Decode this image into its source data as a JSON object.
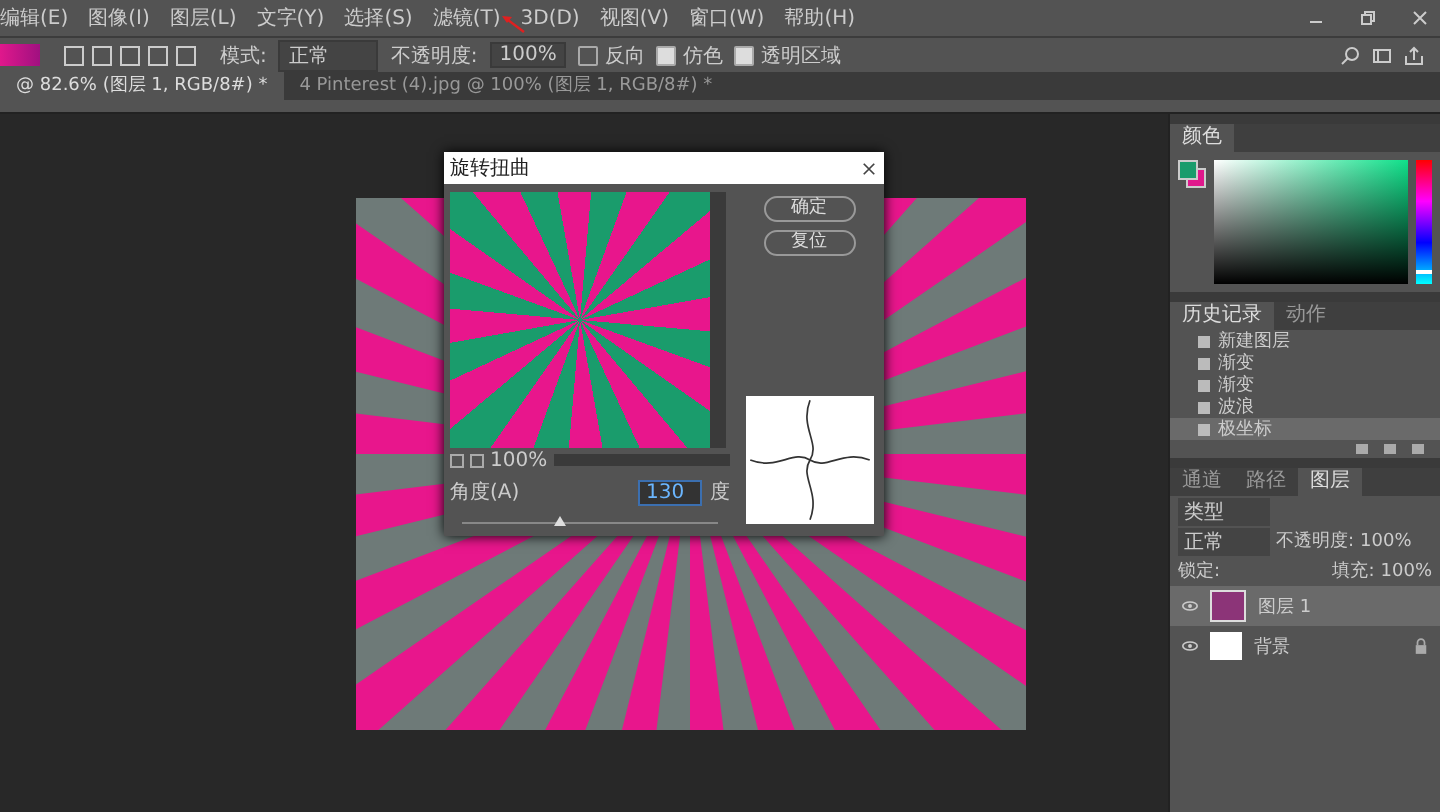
{
  "menu": [
    "编辑(E)",
    "图像(I)",
    "图层(L)",
    "文字(Y)",
    "选择(S)",
    "滤镜(T)",
    "3D(D)",
    "视图(V)",
    "窗口(W)",
    "帮助(H)"
  ],
  "options": {
    "mode_label": "模式:",
    "mode": "正常",
    "opacity_label": "不透明度:",
    "opacity": "100%",
    "toggles": [
      {
        "label": "反向",
        "checked": false
      },
      {
        "label": "仿色",
        "checked": true
      },
      {
        "label": "透明区域",
        "checked": true
      }
    ]
  },
  "doc_tabs": [
    {
      "label": "@ 82.6% (图层 1, RGB/8#) *",
      "selected": true
    },
    {
      "label": "4 Pinterest (4).jpg @ 100% (图层 1, RGB/8#) *",
      "selected": false
    }
  ],
  "dialog": {
    "title": "旋转扭曲",
    "buttons": [
      "确定",
      "复位"
    ],
    "zoom": "100%",
    "angle_label": "角度(A)",
    "angle_value": "130",
    "unit": "度",
    "level": 0.38
  },
  "color_panel": {
    "tab": "颜色",
    "hue_slider": {
      "level": 0.92
    }
  },
  "history": {
    "tabs": [
      {
        "label": "历史记录",
        "selected": true
      },
      {
        "label": "动作",
        "selected": false
      }
    ],
    "items": [
      {
        "label": "新建图层",
        "selected": false
      },
      {
        "label": "渐变",
        "selected": false
      },
      {
        "label": "渐变",
        "selected": false
      },
      {
        "label": "波浪",
        "selected": false
      },
      {
        "label": "极坐标",
        "selected": true
      }
    ]
  },
  "layers": {
    "tabs": [
      {
        "label": "通道",
        "selected": false
      },
      {
        "label": "路径",
        "selected": false
      },
      {
        "label": "图层",
        "selected": true
      }
    ],
    "filter": "类型",
    "blend": "正常",
    "opacity_label": "不透明度:",
    "opacity": "100%",
    "lock_label": "锁定:",
    "fill_label": "填充:",
    "fill": "100%",
    "items": [
      {
        "name": "图层 1",
        "selected": true,
        "kind": "layer"
      },
      {
        "name": "背景",
        "selected": false,
        "kind": "background"
      }
    ]
  }
}
